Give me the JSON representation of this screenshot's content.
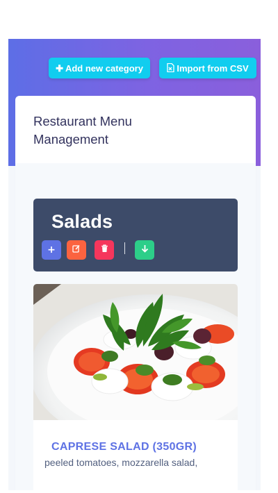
{
  "toolbar": {
    "add_category_label": "Add new category",
    "import_label": "Import from CSV"
  },
  "header": {
    "title": "Restaurant Menu Management"
  },
  "category": {
    "name": "Salads"
  },
  "item": {
    "name": "CAPRESE SALAD (350GR)",
    "description": "peeled tomatoes, mozzarella salad,"
  },
  "colors": {
    "accent_info": "#11cdef",
    "primary": "#5e72e4",
    "warning": "#fb6340",
    "danger": "#f5365c",
    "success": "#2dce89",
    "category_bg": "#3d4b69"
  },
  "icons": {
    "add_category": "plus-icon",
    "import": "file-csv-icon",
    "add_item": "plus-icon",
    "edit_category": "edit-icon",
    "delete_category": "trash-icon",
    "move_down": "arrow-down-icon"
  }
}
